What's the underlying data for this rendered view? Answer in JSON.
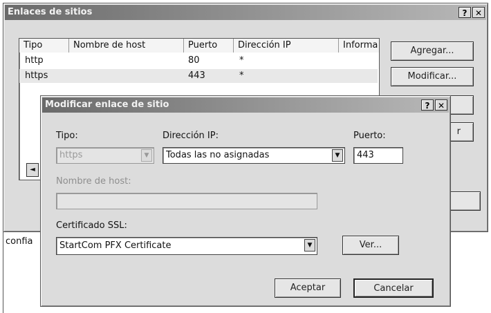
{
  "outer": {
    "title": "Enlaces de sitios",
    "help": "?",
    "close": "✕",
    "columns": [
      "Tipo",
      "Nombre de host",
      "Puerto",
      "Dirección IP",
      "Informa"
    ],
    "rows": [
      {
        "tipo": "http",
        "host": "",
        "puerto": "80",
        "ip": "*"
      },
      {
        "tipo": "https",
        "host": "",
        "puerto": "443",
        "ip": "*"
      }
    ],
    "buttons": {
      "agregar": "Agregar...",
      "modificar": "Modificar...",
      "partial": "r"
    },
    "scroll_left": "◄",
    "behind_text": "confia"
  },
  "dialog": {
    "title": "Modificar enlace de sitio",
    "help": "?",
    "close": "✕",
    "tipo_label": "Tipo:",
    "tipo_value": "https",
    "ip_label": "Dirección IP:",
    "ip_value": "Todas las no asignadas",
    "puerto_label": "Puerto:",
    "puerto_value": "443",
    "host_label": "Nombre de host:",
    "host_value": "",
    "ssl_label": "Certificado SSL:",
    "ssl_value": "StartCom PFX Certificate",
    "ver_button": "Ver...",
    "aceptar_button": "Aceptar",
    "cancelar_button": "Cancelar",
    "dropdown_arrow": "▼"
  }
}
